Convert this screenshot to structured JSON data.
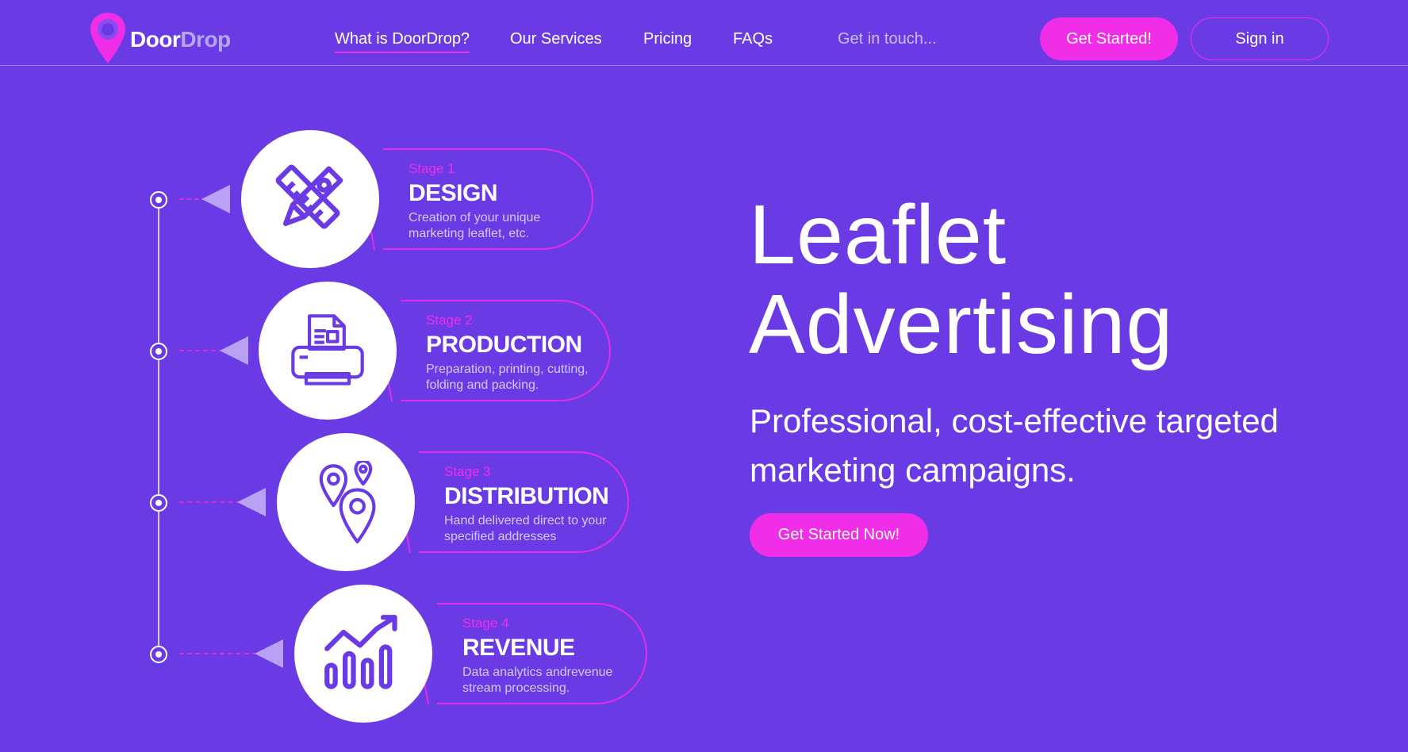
{
  "brand": {
    "name_part1": "Door",
    "name_part2": "Drop",
    "accent_color": "#f02ee8",
    "background_color": "#6a3be4",
    "logo_icon": "map-pin-icon"
  },
  "nav": {
    "links": [
      {
        "label": "What is DoorDrop?",
        "active": true
      },
      {
        "label": "Our Services"
      },
      {
        "label": "Pricing"
      },
      {
        "label": "FAQs"
      },
      {
        "label": "Get in touch..."
      }
    ],
    "cta_label": "Get Started!",
    "signin_label": "Sign in"
  },
  "stages": [
    {
      "number_label": "Stage 1",
      "title": "DESIGN",
      "description": "Creation of your unique marketing leaflet, etc.",
      "icon": "design-tools-icon"
    },
    {
      "number_label": "Stage 2",
      "title": "PRODUCTION",
      "description": "Preparation, printing, cutting, folding and packing.",
      "icon": "printer-icon"
    },
    {
      "number_label": "Stage 3",
      "title": "DISTRIBUTION",
      "description": "Hand delivered direct to your specified addresses",
      "icon": "location-pins-icon"
    },
    {
      "number_label": "Stage 4",
      "title": "REVENUE",
      "description": "Data analytics andrevenue stream processing.",
      "icon": "growth-chart-icon"
    }
  ],
  "hero": {
    "title_line1": "Leaflet",
    "title_line2": "Advertising",
    "subtitle": "Professional, cost-effective targeted marketing campaigns.",
    "cta_label": "Get Started Now!"
  }
}
